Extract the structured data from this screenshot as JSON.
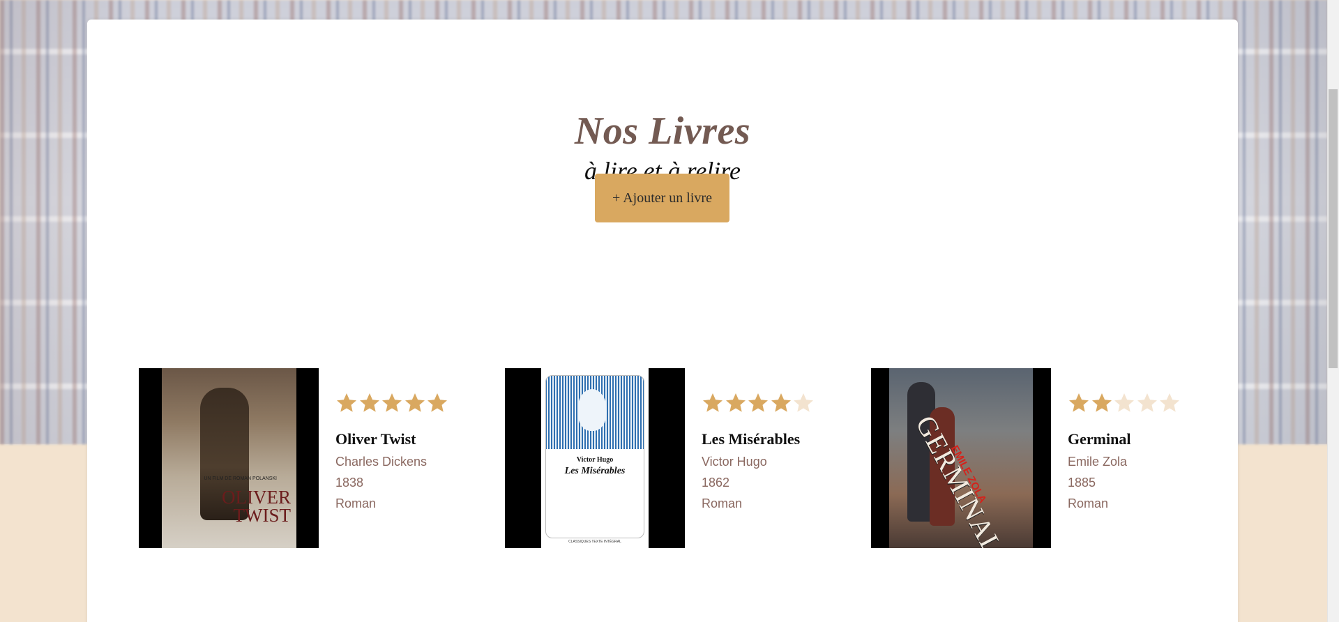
{
  "header": {
    "title": "Nos Livres",
    "subtitle": "à lire et à relire",
    "add_button_label": "+ Ajouter un livre"
  },
  "colors": {
    "accent": "#d9a860",
    "star_filled": "#d9a860",
    "star_empty": "#f3e3cf",
    "title": "#735a52",
    "meta_text": "#8a6860",
    "page_bottom": "#f3e3cf"
  },
  "books": [
    {
      "title": "Oliver Twist",
      "author": "Charles Dickens",
      "year": "1838",
      "genre": "Roman",
      "rating": 5,
      "max_rating": 5,
      "cover": {
        "text_main": "OLIVER TWIST",
        "text_top": "UN FILM DE ROMAN POLANSKI"
      }
    },
    {
      "title": "Les Misérables",
      "author": "Victor Hugo",
      "year": "1862",
      "genre": "Roman",
      "rating": 4,
      "max_rating": 5,
      "cover": {
        "text_author": "Victor Hugo",
        "text_main": "Les Misérables",
        "text_publisher": "CLASSIQUES TEXTE INTÉGRAL"
      }
    },
    {
      "title": "Germinal",
      "author": "Emile Zola",
      "year": "1885",
      "genre": "Roman",
      "rating": 2,
      "max_rating": 5,
      "cover": {
        "text_main": "GERMINAL",
        "text_author": "EMILE ZOLA"
      }
    }
  ]
}
